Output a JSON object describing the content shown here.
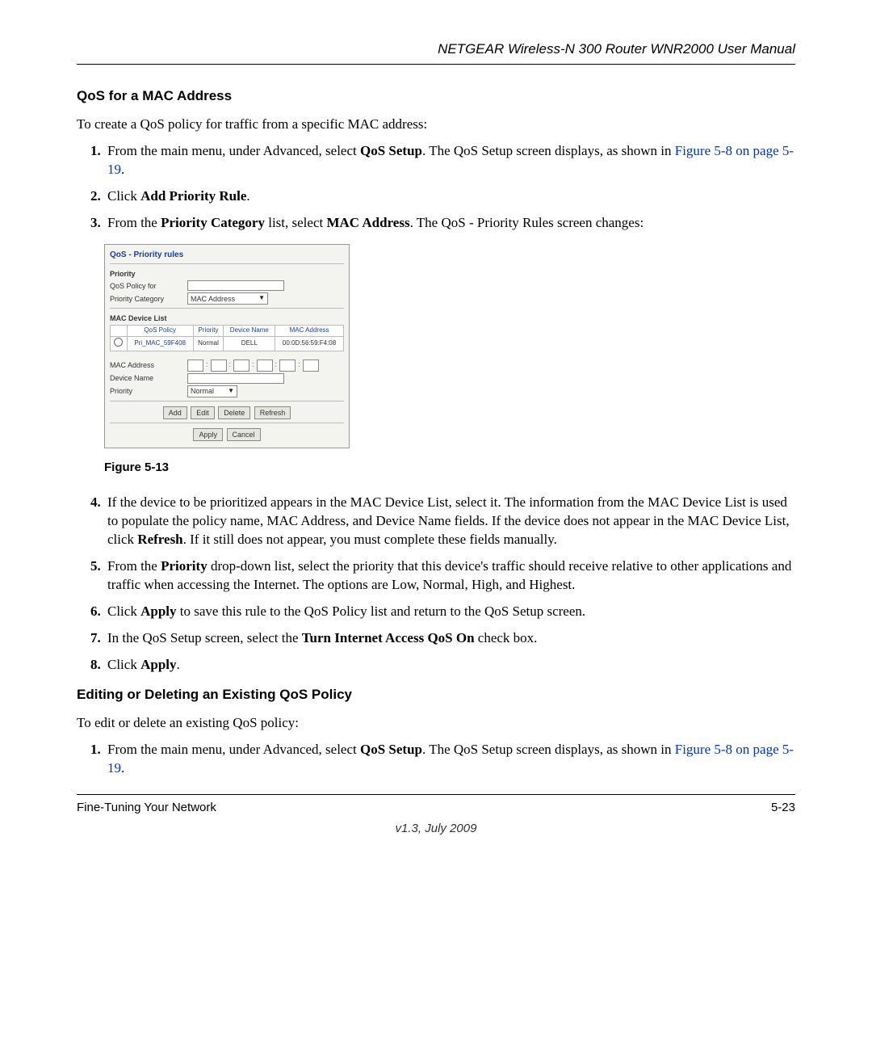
{
  "header": {
    "title": "NETGEAR Wireless-N 300 Router WNR2000 User Manual"
  },
  "section1": {
    "title": "QoS for a MAC Address",
    "intro": "To create a QoS policy for traffic from a specific MAC address:"
  },
  "steps1": {
    "s1a": "From the main menu, under Advanced, select ",
    "s1b": "QoS Setup",
    "s1c": ". The QoS Setup screen displays, as shown in ",
    "s1link": "Figure 5-8 on page 5-19",
    "s1d": ".",
    "s2a": "Click ",
    "s2b": "Add Priority Rule",
    "s2c": ".",
    "s3a": "From the ",
    "s3b": "Priority Category",
    "s3c": " list, select ",
    "s3d": "MAC Address",
    "s3e": ". The QoS - Priority Rules screen changes:"
  },
  "figure": {
    "caption": "Figure 5-13",
    "panel_title": "QoS - Priority rules",
    "priority_label": "Priority",
    "policy_for_label": "QoS Policy for",
    "priority_category_label": "Priority Category",
    "priority_category_value": "MAC Address",
    "mac_device_list_label": "MAC Device List",
    "table": {
      "headers": [
        "",
        "QoS Policy",
        "Priority",
        "Device Name",
        "MAC Address"
      ],
      "row": [
        "Pri_MAC_59F408",
        "Normal",
        "DELL",
        "00:0D:56:59:F4:08"
      ]
    },
    "mac_address_label": "MAC Address",
    "device_name_label": "Device Name",
    "priority_field_label": "Priority",
    "priority_field_value": "Normal",
    "btn_add": "Add",
    "btn_edit": "Edit",
    "btn_delete": "Delete",
    "btn_refresh": "Refresh",
    "btn_apply": "Apply",
    "btn_cancel": "Cancel"
  },
  "steps2": {
    "s4a": "If the device to be prioritized appears in the MAC Device List, select it. The information from the MAC Device List is used to populate the policy name, MAC Address, and Device Name fields. If the device does not appear in the MAC Device List, click ",
    "s4b": "Refresh",
    "s4c": ". If it still does not appear, you must complete these fields manually.",
    "s5a": "From the ",
    "s5b": "Priority",
    "s5c": " drop-down list, select the priority that this device's traffic should receive relative to other applications and traffic when accessing the Internet. The options are Low, Normal, High, and Highest.",
    "s6a": "Click ",
    "s6b": "Apply",
    "s6c": " to save this rule to the QoS Policy list and return to the QoS Setup screen.",
    "s7a": "In the QoS Setup screen, select the ",
    "s7b": "Turn Internet Access QoS On",
    "s7c": " check box.",
    "s8a": "Click ",
    "s8b": "Apply",
    "s8c": "."
  },
  "section2": {
    "title": "Editing or Deleting an Existing QoS Policy",
    "intro": "To edit or delete an existing QoS policy:"
  },
  "steps3": {
    "s1a": "From the main menu, under Advanced, select ",
    "s1b": "QoS Setup",
    "s1c": ". The QoS Setup screen displays, as shown in ",
    "s1link": "Figure 5-8 on page 5-19",
    "s1d": "."
  },
  "footer": {
    "left": "Fine-Tuning Your Network",
    "right": "5-23",
    "center": "v1.3, July 2009"
  }
}
